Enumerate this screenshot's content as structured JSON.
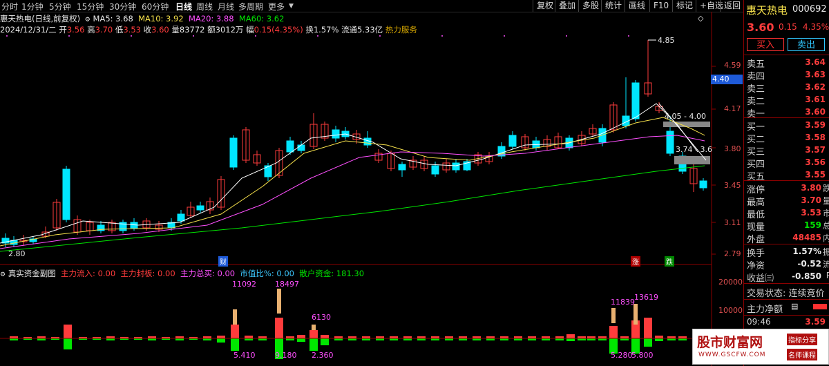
{
  "toolbar": {
    "tabs": [
      "分时",
      "1分钟",
      "5分钟",
      "15分钟",
      "30分钟",
      "60分钟",
      "日线",
      "周线",
      "月线",
      "多周期",
      "更多"
    ],
    "right_buttons": [
      "复权",
      "叠加",
      "多股",
      "统计",
      "画线",
      "F10",
      "标记",
      "+自选",
      "返回"
    ]
  },
  "chart_info": {
    "name_period": "惠天热电(日线,前复权)",
    "ma5_label": "MA5: 3.68",
    "ma10_label": "MA10: 3.92",
    "ma20_label": "MA20: 3.88",
    "ma60_label": "MA60: 3.62",
    "date": "2024/12/31/二",
    "open_label": "开",
    "open_value": "3.56",
    "high_label": "高",
    "high_value": "3.70",
    "low_label": "低",
    "low_value": "3.53",
    "close_label": "收",
    "close_value": "3.60",
    "vol_label": "量",
    "vol_value": "83772",
    "amt_label": "额",
    "amt_value": "3012万",
    "chg_label": "幅",
    "chg_value": "0.15(4.35%)",
    "turnover": "换1.57%",
    "float": "流通5.33亿",
    "concept": "热力服务"
  },
  "price_axis": [
    "4.59",
    "4.17",
    "3.80",
    "3.45",
    "3.11",
    "2.79"
  ],
  "price_marker": "4.40",
  "annotations": {
    "high_price": "4.85",
    "low_price": "2.80",
    "seg1": "4.05 - 4.00",
    "seg2": "3.74 - 3.6",
    "tag_cai": "财",
    "tag_zhang": "涨",
    "tag_die": "跌"
  },
  "sub_info": {
    "title": "真实资金副图",
    "f1": "主力流入: 0.00",
    "f2": "主力封板: 0.00",
    "f3": "主力总买: 0.00",
    "f4": "市值比%: 0.00",
    "f5": "散户资金: 181.30"
  },
  "sub_axis": [
    "20000",
    "10000"
  ],
  "sub_labels": {
    "a": "11092",
    "b": "18497",
    "c": "6130",
    "d": "11839",
    "e": "13619",
    "f": "5.410",
    "g": "9.180",
    "h": "2.360",
    "i": "5.280",
    "j": "5.800"
  },
  "quote": {
    "name": "惠天热电",
    "code": "000692",
    "price": "3.60",
    "change": "0.15",
    "pct": "4.35%",
    "buy_btn": "买入",
    "sell_btn": "卖出",
    "asks": [
      {
        "label": "卖五",
        "price": "3.64"
      },
      {
        "label": "卖四",
        "price": "3.63"
      },
      {
        "label": "卖三",
        "price": "3.62"
      },
      {
        "label": "卖二",
        "price": "3.61"
      },
      {
        "label": "卖一",
        "price": "3.60"
      }
    ],
    "bids": [
      {
        "label": "买一",
        "price": "3.59"
      },
      {
        "label": "买二",
        "price": "3.58"
      },
      {
        "label": "买三",
        "price": "3.57"
      },
      {
        "label": "买四",
        "price": "3.56"
      },
      {
        "label": "买五",
        "price": "3.55"
      }
    ],
    "stats1": [
      {
        "label": "涨停",
        "value": "3.80",
        "tail": "跌"
      },
      {
        "label": "最高",
        "value": "3.70",
        "tail": "量"
      },
      {
        "label": "最低",
        "value": "3.53",
        "tail": "市"
      },
      {
        "label": "现量",
        "value": "159",
        "tail": "总"
      },
      {
        "label": "外盘",
        "value": "48485",
        "tail": "内"
      }
    ],
    "stats2": [
      {
        "label": "换手",
        "value": "1.57%",
        "tail": "振"
      },
      {
        "label": "净资",
        "value": "-0.52",
        "tail": "流"
      },
      {
        "label": "收益㈢",
        "value": "-0.850",
        "tail": "P"
      }
    ],
    "trade_status": "交易状态: 连续竞价",
    "main_net": "主力净额",
    "tick_time": "09:46",
    "tick_price": "3.59"
  },
  "watermark": {
    "title": "股市财富网",
    "url": "WWW.GSCFW.COM",
    "tag1": "指标分享",
    "tag2": "名师课程"
  },
  "colors": {
    "up": "#ff3c3c",
    "down": "#00e6ff",
    "ma5": "#ffffff",
    "ma10": "#f5e04b",
    "ma20": "#ff50ff",
    "ma60": "#00e600"
  }
}
